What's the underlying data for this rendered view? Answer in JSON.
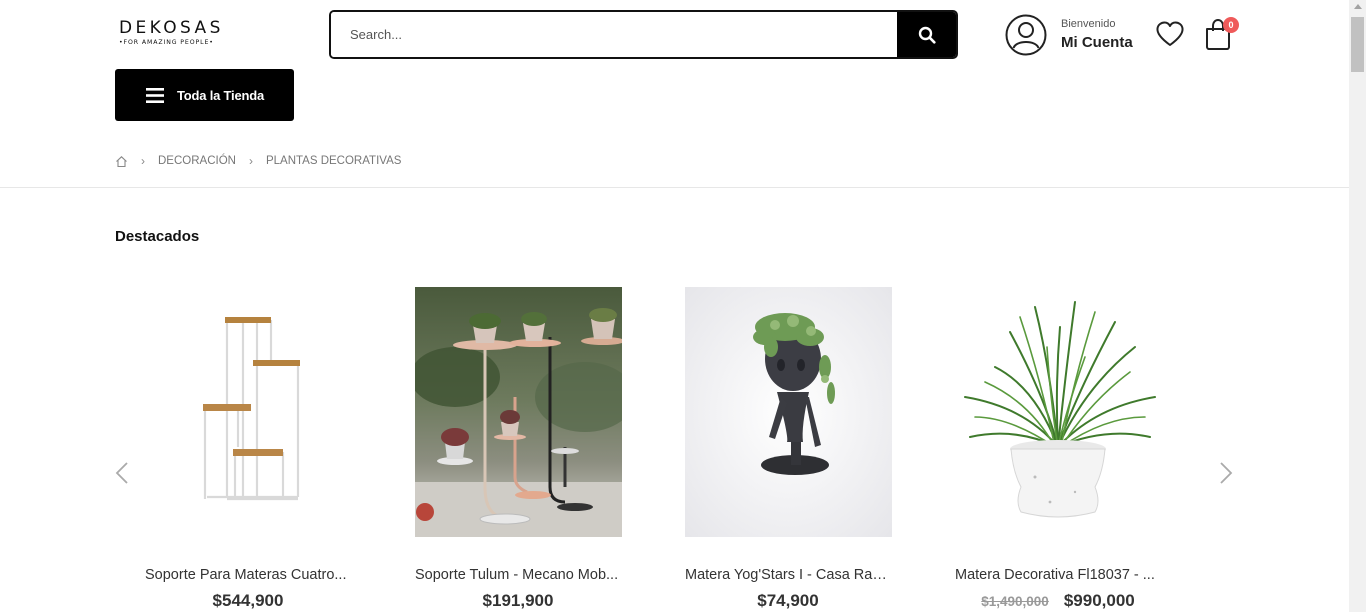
{
  "header": {
    "logo_main": "DEKOSAS",
    "logo_sub": "•FOR AMAZING PEOPLE•",
    "search_placeholder": "Search...",
    "account_welcome": "Bienvenido",
    "account_name": "Mi Cuenta",
    "cart_count": "0",
    "store_button": "Toda la Tienda"
  },
  "breadcrumb": {
    "home_icon": "home-icon",
    "items": [
      "DECORACIÓN",
      "PLANTAS DECORATIVAS"
    ]
  },
  "section": {
    "title": "Destacados"
  },
  "products": [
    {
      "name": "Soporte Para Materas Cuatro...",
      "price": "$544,900",
      "old_price": ""
    },
    {
      "name": "Soporte Tulum - Mecano Mob...",
      "price": "$191,900",
      "old_price": ""
    },
    {
      "name": "Matera Yog'Stars I - Casa Rakau",
      "price": "$74,900",
      "old_price": ""
    },
    {
      "name": "Matera Decorativa Fl18037 - ...",
      "price": "$990,000",
      "old_price": "$1,490,000"
    }
  ],
  "colors": {
    "accent": "#000000",
    "badge": "#ef5a5a",
    "text": "#333333"
  }
}
